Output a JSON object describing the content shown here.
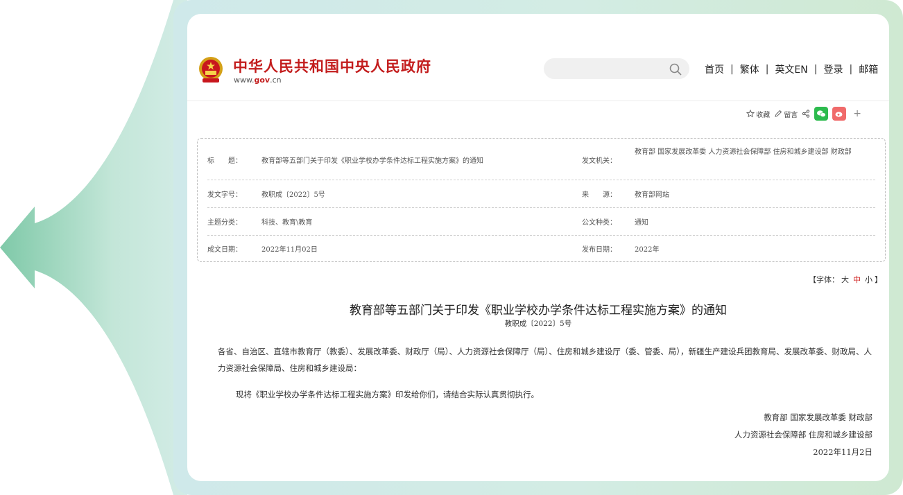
{
  "header": {
    "site_title": "中华人民共和国中央人民政府",
    "site_url_prefix": "www.",
    "site_url_domain": "gov",
    "site_url_suffix": ".cn",
    "search_placeholder": "",
    "nav": [
      "首页",
      "繁体",
      "英文EN",
      "登录",
      "邮箱"
    ]
  },
  "share_bar": {
    "favorite_label": "收藏",
    "comment_label": "留言",
    "icons": [
      "star-icon",
      "pen-icon",
      "share-icon",
      "wechat-icon",
      "weibo-icon",
      "plus-icon"
    ]
  },
  "meta": {
    "rows": [
      {
        "label1": "标　　题：",
        "value1": "教育部等五部门关于印发《职业学校办学条件达标工程实施方案》的通知",
        "label2": "发文机关：",
        "value2": "教育部 国家发展改革委 人力资源社会保障部 住房和城乡建设部 财政部"
      },
      {
        "label1": "发文字号：",
        "value1": "教职成〔2022〕5号",
        "label2": "来　　源：",
        "value2": "教育部网站"
      },
      {
        "label1": "主题分类：",
        "value1": "科技、教育\\教育",
        "label2": "公文种类：",
        "value2": "通知"
      },
      {
        "label1": "成文日期：",
        "value1": "2022年11月02日",
        "label2": "发布日期：",
        "value2": "2022年"
      }
    ]
  },
  "font_size": {
    "prefix": "【字体：",
    "large": "大",
    "medium": "中",
    "small": "小",
    "suffix": "】"
  },
  "document": {
    "title": "教育部等五部门关于印发《职业学校办学条件达标工程实施方案》的通知",
    "number": "教职成〔2022〕5号",
    "recipients": "各省、自治区、直辖市教育厅（教委）、发展改革委、财政厅（局）、人力资源社会保障厅（局）、住房和城乡建设厅（委、管委、局），新疆生产建设兵团教育局、发展改革委、财政局、人力资源社会保障局、住房和城乡建设局：",
    "paragraph": "现将《职业学校办学条件达标工程实施方案》印发给你们，请结合实际认真贯彻执行。",
    "signature_line1": "教育部 国家发展改革委 财政部",
    "signature_line2": "人力资源社会保障部 住房和城乡建设部",
    "signature_date": "2022年11月2日"
  },
  "colors": {
    "brand_red": "#c31d1d",
    "frame_green": "#cfe9d2",
    "arrow_green": "#7fc9a8"
  }
}
